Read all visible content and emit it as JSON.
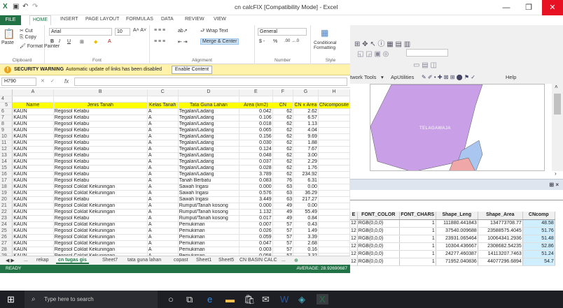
{
  "window": {
    "title": "cn calcFIX [Compatibility Mode] - Excel",
    "minimize": "—",
    "restore": "❐",
    "close": "✕"
  },
  "tabs": [
    "FILE",
    "HOME",
    "INSERT",
    "PAGE LAYOUT",
    "FORMULAS",
    "DATA",
    "REVIEW",
    "VIEW"
  ],
  "ribbon": {
    "cut": "Cut",
    "copy": "Copy",
    "paste": "Paste",
    "format_painter": "Format Painter",
    "clipboard": "Clipboard",
    "font_name": "Arial",
    "font_size": "10",
    "font_group": "Font",
    "wrap_text": "Wrap Text",
    "merge_center": "Merge & Center",
    "alignment": "Alignment",
    "number_format": "General",
    "number": "Number",
    "conditional_formatting": "Conditional Formatting",
    "styles": "Style",
    "bold": "B",
    "italic": "I",
    "underline": "U",
    "percent": "%",
    "dollar": "$ -"
  },
  "security": {
    "title": "SECURITY WARNING",
    "message": "Automatic update of links has been disabled",
    "button": "Enable Content"
  },
  "formula_bar": {
    "name_box": "H790",
    "fx": "fx"
  },
  "grid": {
    "columns": [
      "A",
      "B",
      "C",
      "D",
      "E",
      "F",
      "G",
      "H"
    ],
    "header_row": {
      "num": "5",
      "cells": [
        "Name",
        "Jenis Tanah",
        "Kelas Tanah",
        "Tata Guna Lahan",
        "Area (km2)",
        "CN",
        "CN x Area",
        "CNcomposite"
      ]
    },
    "rows": [
      [
        "6",
        "KAUN",
        "Regosol Kelabu",
        "A",
        "Tegalan/Ladang",
        "0.042",
        "62",
        "2.62"
      ],
      [
        "7",
        "KAUN",
        "Regosol Kelabu",
        "A",
        "Tegalan/Ladang",
        "0.106",
        "62",
        "6.57"
      ],
      [
        "8",
        "KAUN",
        "Regosol Kelabu",
        "A",
        "Tegalan/Ladang",
        "0.018",
        "62",
        "1.13"
      ],
      [
        "9",
        "KAUN",
        "Regosol Kelabu",
        "A",
        "Tegalan/Ladang",
        "0.065",
        "62",
        "4.04"
      ],
      [
        "10",
        "KAUN",
        "Regosol Kelabu",
        "A",
        "Tegalan/Ladang",
        "0.156",
        "62",
        "9.69"
      ],
      [
        "11",
        "KAUN",
        "Regosol Kelabu",
        "A",
        "Tegalan/Ladang",
        "0.030",
        "62",
        "1.88"
      ],
      [
        "12",
        "KAUN",
        "Regosol Kelabu",
        "A",
        "Tegalan/Ladang",
        "0.124",
        "62",
        "7.67"
      ],
      [
        "13",
        "KAUN",
        "Regosol Kelabu",
        "A",
        "Tegalan/Ladang",
        "0.048",
        "62",
        "3.00"
      ],
      [
        "14",
        "KAUN",
        "Regosol Kelabu",
        "A",
        "Tegalan/Ladang",
        "0.037",
        "62",
        "2.29"
      ],
      [
        "15",
        "KAUN",
        "Regosol Kelabu",
        "A",
        "Tegalan/Ladang",
        "0.028",
        "62",
        "1.76"
      ],
      [
        "16",
        "KAUN",
        "Regosol Kelabu",
        "A",
        "Tegalan/Ladang",
        "3.789",
        "62",
        "234.92"
      ],
      [
        "17",
        "KAUN",
        "Regosol Kelabu",
        "A",
        "Tanah Berbatu",
        "0.083",
        "76",
        "6.31"
      ],
      [
        "18",
        "KAUN",
        "Regosol Coklat Kekuningan",
        "A",
        "Sawah Irigasi",
        "0.000",
        "63",
        "0.00"
      ],
      [
        "19",
        "KAUN",
        "Regosol Coklat Kekuningan",
        "A",
        "Sawah Irigasi",
        "0.576",
        "63",
        "36.29"
      ],
      [
        "20",
        "KAUN",
        "Regosol Kelabu",
        "A",
        "Sawah Irigasi",
        "3.449",
        "63",
        "217.27"
      ],
      [
        "21",
        "KAUN",
        "Regosol Coklat Kekuningan",
        "A",
        "Rumput/Tanah kosong",
        "0.000",
        "49",
        "0.00"
      ],
      [
        "22",
        "KAUN",
        "Regosol Coklat Kekuningan",
        "A",
        "Rumput/Tanah kosong",
        "1.132",
        "49",
        "55.49"
      ],
      [
        "23",
        "KAUN",
        "Regosol Kelabu",
        "A",
        "Rumput/Tanah kosong",
        "0.017",
        "49",
        "0.84"
      ],
      [
        "24",
        "KAUN",
        "Regosol Coklat Kekuningan",
        "A",
        "Pemukiman",
        "0.007",
        "57",
        "0.43"
      ],
      [
        "25",
        "KAUN",
        "Regosol Coklat Kekuningan",
        "A",
        "Pemukiman",
        "0.026",
        "57",
        "1.49"
      ],
      [
        "26",
        "KAUN",
        "Regosol Coklat Kekuningan",
        "A",
        "Pemukiman",
        "0.059",
        "57",
        "3.39"
      ],
      [
        "27",
        "KAUN",
        "Regosol Coklat Kekuningan",
        "A",
        "Pemukiman",
        "0.047",
        "57",
        "2.68"
      ],
      [
        "28",
        "KAUN",
        "Regosol Coklat Kekuningan",
        "A",
        "Pemukiman",
        "0.003",
        "57",
        "0.16"
      ],
      [
        "29",
        "KAUN",
        "Regosol Coklat Kekuningan",
        "A",
        "Pemukiman",
        "0.058",
        "57",
        "3.32"
      ]
    ]
  },
  "sheet_tabs": [
    "...",
    "rekap",
    "cn tugas gis",
    "Sheet7",
    "tata guna lahan",
    "copast",
    "Sheet1",
    "Sheet5",
    "CN BASIN CALC",
    "..."
  ],
  "active_sheet": "cn tugas gis",
  "status": {
    "ready": "READY",
    "average": "AVERAGE: 28.92690687"
  },
  "arcgis": {
    "toolbar_label": "twork Tools",
    "apputilities": "ApUtilities",
    "help": "Help",
    "map_label": "TELAGAWAJA",
    "attr_headers": [
      "E",
      "FONT_COLOR",
      "FONT_CHARS",
      "Shape_Leng",
      "Shape_Area",
      "CNcomp"
    ],
    "attr_rows": [
      [
        "12",
        "RGB(0,0,0)",
        "1",
        "111880.441843",
        "134773708.77",
        "48.58"
      ],
      [
        "12",
        "RGB(0,0,0)",
        "1",
        "37540.009688",
        "23588575.4045",
        "51.76"
      ],
      [
        "12",
        "RGB(0,0,0)",
        "1",
        "23931.065464",
        "10064341.2936",
        "51.48"
      ],
      [
        "12",
        "RGB(0,0,0)",
        "1",
        "10304.436667",
        "2308682.54235",
        "52.86"
      ],
      [
        "12",
        "RGB(0,0,0)",
        "1",
        "24277.460387",
        "14113207.7463",
        "51.24"
      ],
      [
        "12",
        "RGB(0,0,0)",
        "1",
        "71952.040836",
        "44077296.6894",
        "54.7"
      ]
    ],
    "dock_close": "⊞ ×",
    "attr_close": "×"
  },
  "taskbar": {
    "search": "Type here to search"
  },
  "colors": {
    "excel_green": "#217346",
    "header_yellow": "#ffff00",
    "map_purple": "#c9a0e8",
    "map_blue": "#a9c6f0",
    "map_pink": "#f0a7a7"
  }
}
